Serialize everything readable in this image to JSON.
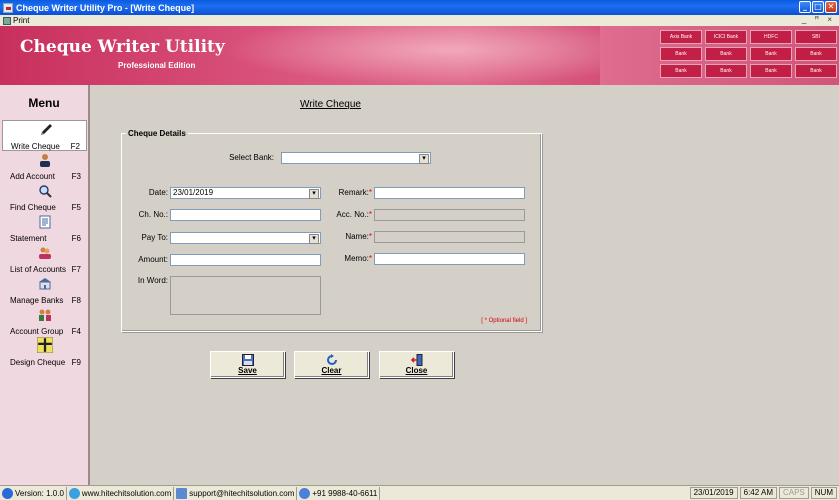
{
  "window": {
    "title": "Cheque Writer Utility Pro - [Write Cheque]",
    "controls": {
      "minimize": "_",
      "maximize": "□",
      "close": "✕"
    }
  },
  "menubar": {
    "print_label": "Print",
    "mdi_controls": "_ ꟸ ×"
  },
  "banner": {
    "title": "Cheque Writer Utility",
    "subtitle": "Professional Edition",
    "tiles": [
      "Axis Bank",
      "ICICI Bank",
      "HDFC",
      "SBI",
      "Bank",
      "Bank",
      "Bank",
      "Bank",
      "Bank",
      "Bank",
      "Bank",
      "Bank"
    ]
  },
  "sidebar": {
    "title": "Menu",
    "items": [
      {
        "label": "Write Cheque",
        "key": "F2",
        "icon": "pen-icon"
      },
      {
        "label": "Add Account",
        "key": "F3",
        "icon": "user-icon"
      },
      {
        "label": "Find Cheque",
        "key": "F5",
        "icon": "magnifier-icon"
      },
      {
        "label": "Statement",
        "key": "F6",
        "icon": "document-icon"
      },
      {
        "label": "List of Accounts",
        "key": "F7",
        "icon": "users-icon"
      },
      {
        "label": "Manage Banks",
        "key": "F8",
        "icon": "bank-icon"
      },
      {
        "label": "Account Group",
        "key": "F4",
        "icon": "group-icon"
      },
      {
        "label": "Design Cheque",
        "key": "F9",
        "icon": "cross-icon"
      }
    ]
  },
  "form": {
    "page_title": "Write Cheque",
    "group_title": "Cheque Details",
    "select_bank_label": "Select Bank:",
    "select_bank_value": "",
    "date_label": "Date:",
    "date_value": "23/01/2019",
    "chno_label": "Ch. No.:",
    "chno_value": "",
    "payto_label": "Pay To:",
    "payto_value": "",
    "amount_label": "Amount:",
    "amount_value": "",
    "inword_label": "In Word:",
    "inword_value": "",
    "remark_label": "Remark:",
    "remark_value": "",
    "accno_label": "Acc. No.:",
    "accno_value": "",
    "name_label": "Name:",
    "name_value": "",
    "memo_label": "Memo:",
    "memo_value": "",
    "required_mark": "*",
    "optional_note": "[ * Optional field ]"
  },
  "buttons": {
    "save": "Save",
    "clear": "Clear",
    "close": "Close"
  },
  "statusbar": {
    "version": "Version: 1.0.0",
    "website": "www.hitechitsolution.com",
    "email": "support@hitechitsolution.com",
    "phone": "+91 9988-40-6611",
    "date": "23/01/2019",
    "time": "6:42 AM",
    "caps": "CAPS",
    "num": "NUM"
  },
  "colors": {
    "banner_accent": "#d24a74",
    "sidebar_bg": "#f0d8e0",
    "required": "#d00000"
  }
}
